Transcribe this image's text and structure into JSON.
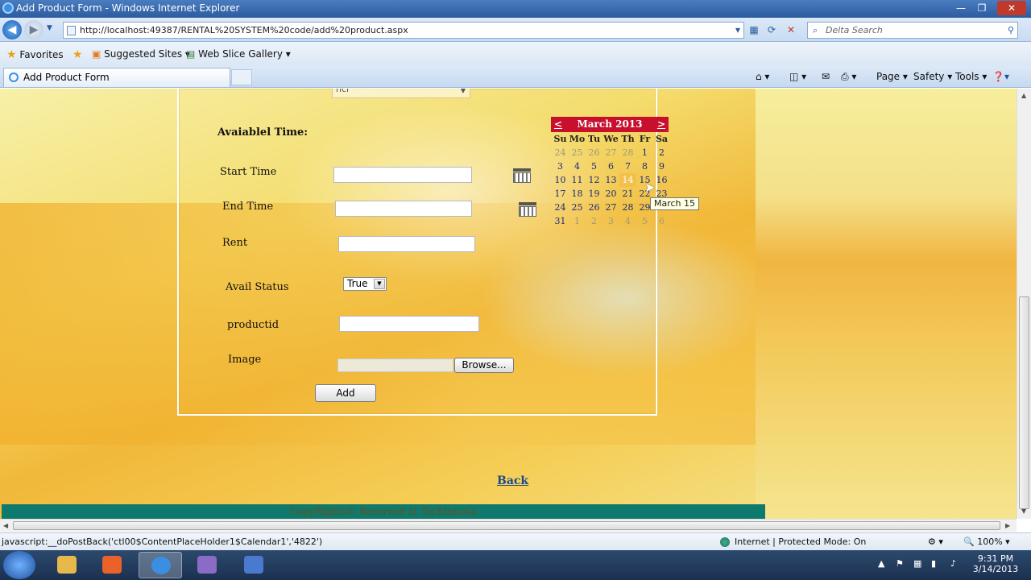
{
  "window": {
    "title": "Add Product Form - Windows Internet Explorer",
    "minimize": "—",
    "maximize": "❐",
    "close": "✕"
  },
  "address_bar": {
    "url": "http://localhost:49387/RENTAL%20SYSTEM%20code/add%20product.aspx",
    "search_placeholder": "Delta Search"
  },
  "favorites_bar": {
    "favorites_label": "Favorites",
    "suggested_sites": "Suggested Sites ▾",
    "web_slice_gallery": "Web Slice Gallery ▾"
  },
  "tab": {
    "label": "Add Product Form"
  },
  "command_bar": {
    "page": "Page ▾",
    "safety": "Safety ▾",
    "tools": "Tools ▾"
  },
  "form": {
    "top_select_text": "ncr",
    "section_label": "Avaiablel Time:",
    "start_time_label": "Start Time",
    "end_time_label": "End Time",
    "rent_label": "Rent",
    "avail_status_label": "Avail Status",
    "avail_status_value": "True",
    "productid_label": "productid",
    "image_label": "Image",
    "browse_button": "Browse...",
    "add_button": "Add"
  },
  "calendar": {
    "month_title": "March 2013",
    "prev": "<",
    "next": ">",
    "day_names": [
      "Su",
      "Mo",
      "Tu",
      "We",
      "Th",
      "Fr",
      "Sa"
    ],
    "weeks": [
      [
        "24",
        "25",
        "26",
        "27",
        "28",
        "1",
        "2"
      ],
      [
        "3",
        "4",
        "5",
        "6",
        "7",
        "8",
        "9"
      ],
      [
        "10",
        "11",
        "12",
        "13",
        "14",
        "15",
        "16"
      ],
      [
        "17",
        "18",
        "19",
        "20",
        "21",
        "22",
        "23"
      ],
      [
        "24",
        "25",
        "26",
        "27",
        "28",
        "29",
        "30"
      ],
      [
        "31",
        "1",
        "2",
        "3",
        "4",
        "5",
        "6"
      ]
    ],
    "other_month_cells": [
      [
        0,
        0
      ],
      [
        0,
        1
      ],
      [
        0,
        2
      ],
      [
        0,
        3
      ],
      [
        0,
        4
      ],
      [
        5,
        1
      ],
      [
        5,
        2
      ],
      [
        5,
        3
      ],
      [
        5,
        4
      ],
      [
        5,
        5
      ],
      [
        5,
        6
      ]
    ],
    "today_cell": [
      2,
      4
    ],
    "tooltip": "March 15",
    "header_color": "#c8102e",
    "today_color": "#f3c14a"
  },
  "page_links": {
    "back": "Back"
  },
  "footer": {
    "text": "CopyRights© Reserved at TechInnova"
  },
  "status_bar": {
    "message": "javascript:__doPostBack('ctl00$ContentPlaceHolder1$Calendar1','4822')",
    "zone": "Internet | Protected Mode: On",
    "zoom": "100%"
  },
  "taskbar": {
    "time": "9:31 PM",
    "date": "3/14/2013"
  }
}
